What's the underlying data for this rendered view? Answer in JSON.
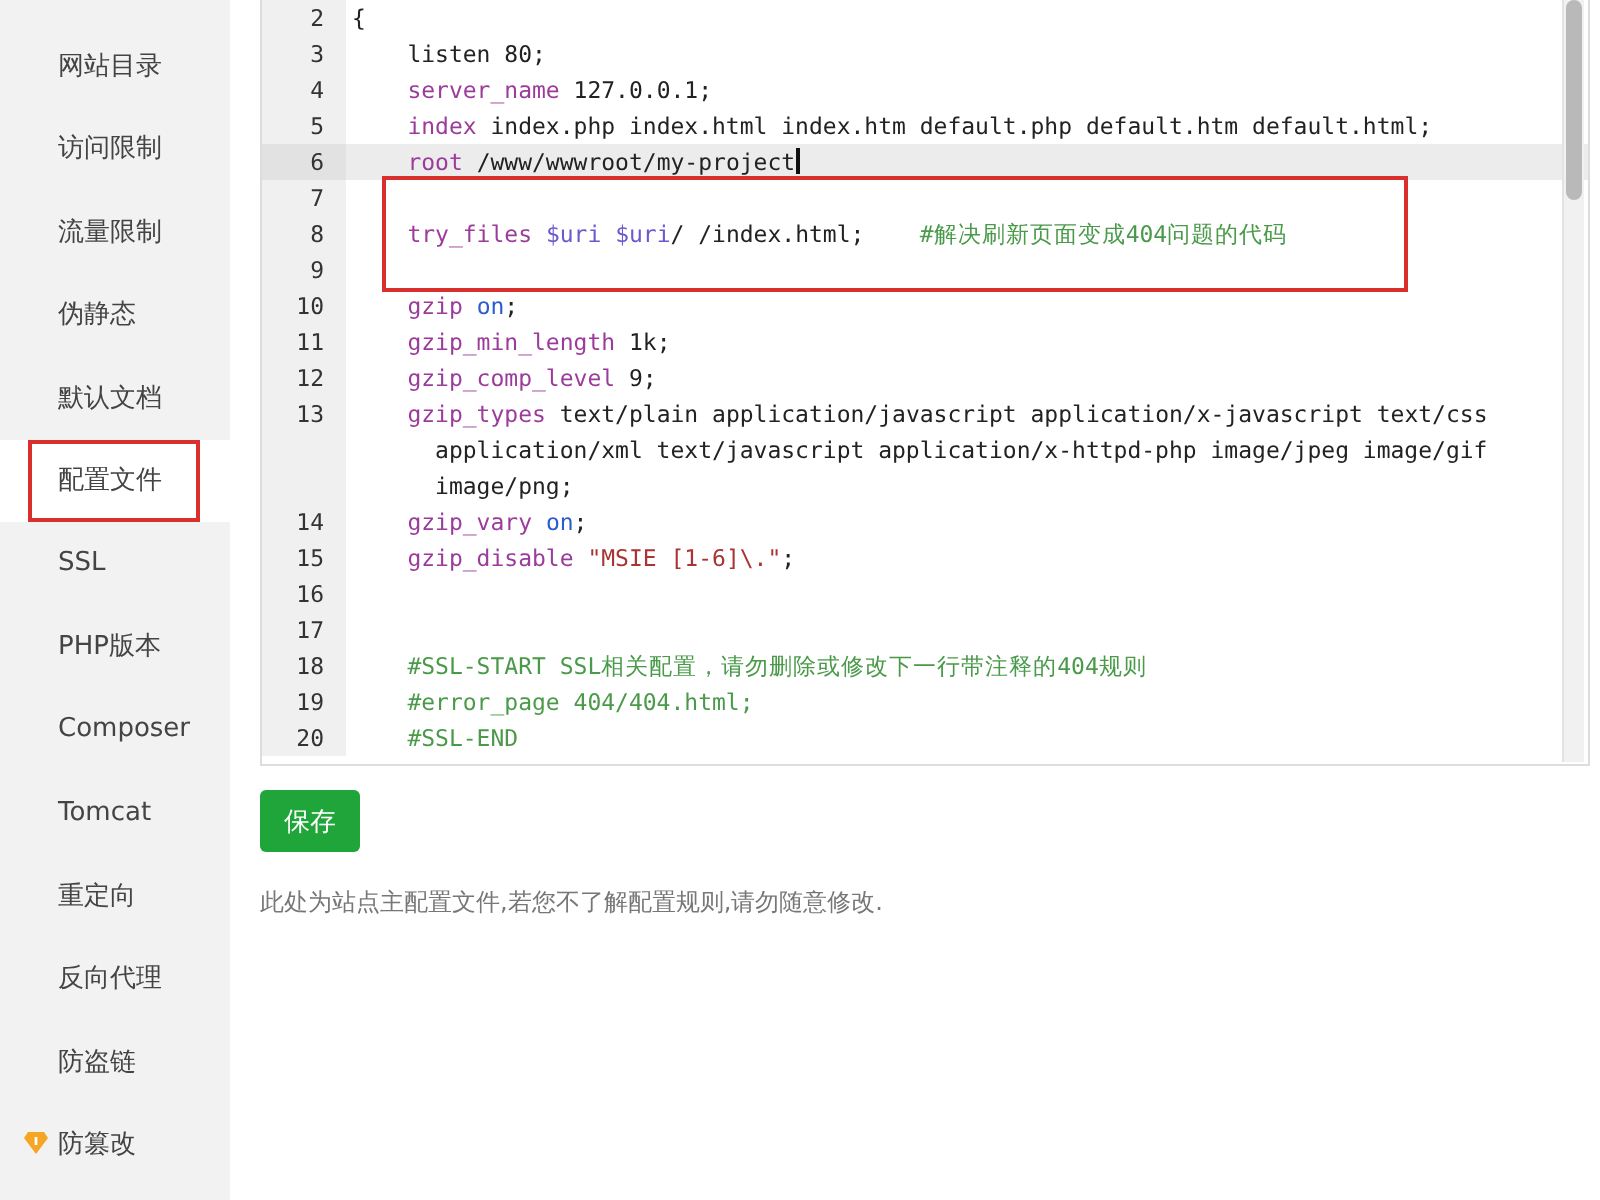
{
  "sidebar": {
    "items": [
      {
        "label": "网站目录",
        "selected": false,
        "annotated": false,
        "kind": "plain"
      },
      {
        "label": "访问限制",
        "selected": false,
        "annotated": false,
        "kind": "plain"
      },
      {
        "label": "流量限制",
        "selected": false,
        "annotated": false,
        "kind": "plain"
      },
      {
        "label": "伪静态",
        "selected": false,
        "annotated": false,
        "kind": "plain"
      },
      {
        "label": "默认文档",
        "selected": false,
        "annotated": false,
        "kind": "plain"
      },
      {
        "label": "配置文件",
        "selected": true,
        "annotated": true,
        "kind": "plain"
      },
      {
        "label": "SSL",
        "selected": false,
        "annotated": false,
        "kind": "plain"
      },
      {
        "label": "PHP版本",
        "selected": false,
        "annotated": false,
        "kind": "plain"
      },
      {
        "label": "Composer",
        "selected": false,
        "annotated": false,
        "kind": "plain"
      },
      {
        "label": "Tomcat",
        "selected": false,
        "annotated": false,
        "kind": "plain"
      },
      {
        "label": "重定向",
        "selected": false,
        "annotated": false,
        "kind": "plain"
      },
      {
        "label": "反向代理",
        "selected": false,
        "annotated": false,
        "kind": "plain"
      },
      {
        "label": "防盗链",
        "selected": false,
        "annotated": false,
        "kind": "plain"
      },
      {
        "label": "防篡改",
        "selected": false,
        "annotated": false,
        "kind": "premium"
      }
    ]
  },
  "editor": {
    "lines": [
      {
        "number": "2",
        "indented": false,
        "current": false,
        "boxed": false,
        "segments": [
          {
            "kind": "plain",
            "text": "{"
          }
        ]
      },
      {
        "number": "3",
        "indented": true,
        "current": false,
        "boxed": false,
        "segments": [
          {
            "kind": "plain",
            "text": "listen 80;"
          }
        ]
      },
      {
        "number": "4",
        "indented": true,
        "current": false,
        "boxed": false,
        "segments": [
          {
            "kind": "directive",
            "text": "server_name"
          },
          {
            "kind": "plain",
            "text": " 127.0.0.1;"
          }
        ]
      },
      {
        "number": "5",
        "indented": true,
        "current": false,
        "boxed": false,
        "segments": [
          {
            "kind": "directive",
            "text": "index"
          },
          {
            "kind": "plain",
            "text": " index.php index.html index.htm default.php default.htm default.html;"
          }
        ]
      },
      {
        "number": "6",
        "indented": true,
        "current": true,
        "boxed": false,
        "segments": [
          {
            "kind": "directive",
            "text": "root"
          },
          {
            "kind": "plain",
            "text": " /www/wwwroot/my-project"
          }
        ]
      },
      {
        "number": "7",
        "current": false,
        "boxed": true
      },
      {
        "number": "8",
        "indented": true,
        "current": false,
        "boxed": true,
        "segments": [
          {
            "kind": "directive",
            "text": "try_files "
          },
          {
            "kind": "variable",
            "text": "$uri "
          },
          {
            "kind": "variable",
            "text": "$uri"
          },
          {
            "kind": "plain",
            "text": "/ /index.html;    "
          },
          {
            "kind": "comment",
            "text": "#解决刷新页面变成404问题的代码"
          }
        ]
      },
      {
        "number": "9",
        "current": false,
        "boxed": true
      },
      {
        "number": "10",
        "indented": true,
        "current": false,
        "boxed": false,
        "segments": [
          {
            "kind": "directive",
            "text": "gzip "
          },
          {
            "kind": "atom",
            "text": "on"
          },
          {
            "kind": "plain",
            "text": ";"
          }
        ]
      },
      {
        "number": "11",
        "indented": true,
        "current": false,
        "boxed": false,
        "segments": [
          {
            "kind": "directive",
            "text": "gzip_min_length"
          },
          {
            "kind": "plain",
            "text": " 1k;"
          }
        ]
      },
      {
        "number": "12",
        "indented": true,
        "current": false,
        "boxed": false,
        "segments": [
          {
            "kind": "directive",
            "text": "gzip_comp_level"
          },
          {
            "kind": "plain",
            "text": " 9;"
          }
        ]
      },
      {
        "number": "13",
        "indented": true,
        "current": false,
        "boxed": false,
        "segments": [
          {
            "kind": "directive",
            "text": "gzip_types"
          },
          {
            "kind": "plain",
            "text": " text/plain application/javascript application/x-javascript text/css application/xml text/javascript application/x-httpd-php image/jpeg image/gif image/png;"
          }
        ]
      },
      {
        "number": "14",
        "indented": true,
        "current": false,
        "boxed": false,
        "segments": [
          {
            "kind": "directive",
            "text": "gzip_vary "
          },
          {
            "kind": "atom",
            "text": "on"
          },
          {
            "kind": "plain",
            "text": ";"
          }
        ]
      },
      {
        "number": "15",
        "indented": true,
        "current": false,
        "boxed": false,
        "segments": [
          {
            "kind": "directive",
            "text": "gzip_disable "
          },
          {
            "kind": "string",
            "text": "\"MSIE [1-6]\\.\""
          },
          {
            "kind": "plain",
            "text": ";"
          }
        ]
      },
      {
        "number": "16",
        "current": false,
        "boxed": false
      },
      {
        "number": "17",
        "current": false,
        "boxed": false
      },
      {
        "number": "18",
        "indented": true,
        "current": false,
        "boxed": false,
        "segments": [
          {
            "kind": "comment",
            "text": "#SSL-START SSL相关配置，请勿删除或修改下一行带注释的404规则"
          }
        ]
      },
      {
        "number": "19",
        "indented": true,
        "current": false,
        "boxed": false,
        "segments": [
          {
            "kind": "comment",
            "text": "#error_page 404/404.html;"
          }
        ]
      },
      {
        "number": "20",
        "indented": true,
        "current": false,
        "boxed": false,
        "segments": [
          {
            "kind": "comment",
            "text": "#SSL-END"
          }
        ]
      }
    ]
  },
  "save_button": "保存",
  "note": "此处为站点主配置文件,若您不了解配置规则,请勿随意修改."
}
